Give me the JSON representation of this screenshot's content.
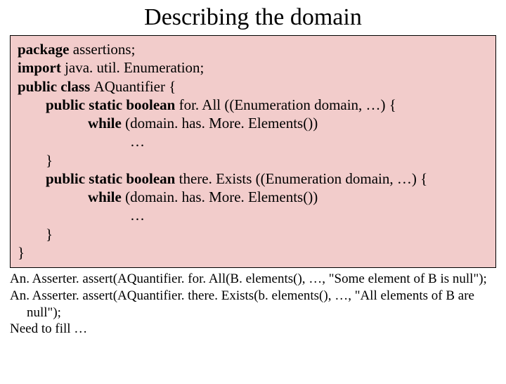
{
  "title": "Describing the domain",
  "code": {
    "l1a": "package ",
    "l1b": "assertions;",
    "l2a": "import ",
    "l2b": "java. util. Enumeration;",
    "l3a": "public class ",
    "l3b": "AQuantifier {",
    "l4a": "public static boolean ",
    "l4b": "for. All ((Enumeration domain, …) {",
    "l5a": "while ",
    "l5b": "(domain. has. More. Elements())",
    "l6": "…",
    "l7": "}",
    "l8a": "public static boolean ",
    "l8b": "there. Exists ((Enumeration domain, …) {",
    "l9a": "while ",
    "l9b": "(domain. has. More. Elements())",
    "l10": "…",
    "l11": "}",
    "l12": "}"
  },
  "below": {
    "b1": "An. Asserter. assert(AQuantifier. for. All(B. elements(), …,  \"Some element of B is null\");",
    "b2": "An. Asserter. assert(AQuantifier. there. Exists(b. elements(), …, \"All elements of B are null\");",
    "b3": "Need to fill …"
  }
}
